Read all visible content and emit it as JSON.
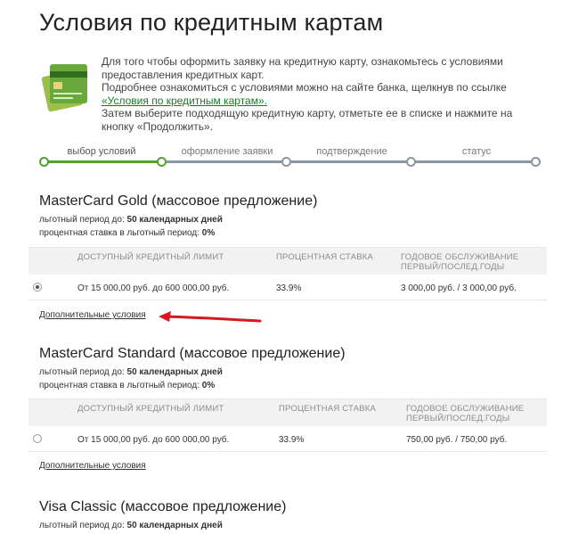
{
  "page": {
    "title": "Условия по кредитным картам"
  },
  "intro": {
    "line1": "Для того чтобы оформить заявку на кредитную карту, ознакомьтесь с условиями предоставления кредитных карт.",
    "line2": "Подробнее ознакомиться с условиями можно на сайте банка, щелкнув по ссылке",
    "link": "«Условия по кредитным картам».",
    "line3": "Затем выберите подходящую кредитную карту, отметьте ее в списке и нажмите на кнопку «Продолжить»."
  },
  "steps": [
    {
      "label": "выбор условий",
      "state": "done"
    },
    {
      "label": "оформление заявки",
      "state": "todo"
    },
    {
      "label": "подтверждение",
      "state": "todo"
    },
    {
      "label": "статус",
      "state": "todo"
    }
  ],
  "columns": {
    "limit": "ДОСТУПНЫЙ КРЕДИТНЫЙ ЛИМИТ",
    "rate": "ПРОЦЕНТНАЯ СТАВКА",
    "fee_line1": "ГОДОВОЕ ОБСЛУЖИВАНИЕ",
    "fee_line2": "ПЕРВЫЙ/ПОСЛЕД.ГОДЫ"
  },
  "meta_labels": {
    "grace": "льготный период до:",
    "grace_rate": "процентная ставка в льготный период:"
  },
  "more_label": "Дополнительные условия",
  "offers": [
    {
      "title": "MasterCard Gold (массовое предложение)",
      "grace_value": "50 календарных дней",
      "grace_rate_value": "0%",
      "limit": "От 15 000,00 руб. до 600 000,00 руб.",
      "rate": "33.9%",
      "fee": "3 000,00 руб. / 3 000,00 руб.",
      "selected": true
    },
    {
      "title": "MasterCard Standard (массовое предложение)",
      "grace_value": "50 календарных дней",
      "grace_rate_value": "0%",
      "limit": "От 15 000,00 руб. до 600 000,00 руб.",
      "rate": "33.9%",
      "fee": "750,00 руб. / 750,00 руб.",
      "selected": false
    },
    {
      "title": "Visa Classic (массовое предложение)",
      "grace_value": "50 календарных дней"
    }
  ],
  "colors": {
    "accent_green": "#4fa52b",
    "link_green": "#1a7a27",
    "arrow_red": "#d8181f",
    "track_grey": "#8a97a4"
  },
  "icons": {
    "card": "credit-card-icon",
    "arrow": "red-arrow-annotation"
  }
}
